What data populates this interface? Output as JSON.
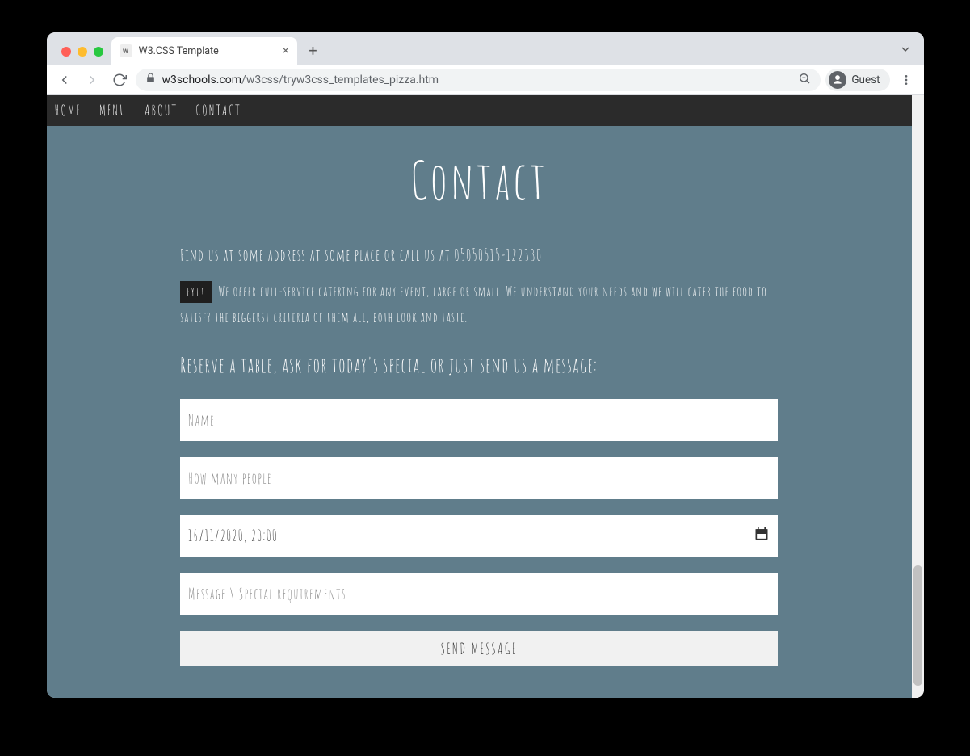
{
  "browser": {
    "tab_title": "W3.CSS Template",
    "url_host": "w3schools.com",
    "url_path": "/w3css/tryw3css_templates_pizza.htm",
    "guest_label": "Guest"
  },
  "nav": {
    "items": [
      "HOME",
      "MENU",
      "ABOUT",
      "CONTACT"
    ]
  },
  "contact": {
    "heading": "Contact",
    "lead": "Find us at some address at some place or call us at 05050515-122330",
    "fyi_tag": "FYI!",
    "fyi_text": "We offer full-service catering for any event, large or small. We understand your needs and we will cater the food to satisfy the biggerst criteria of them all, both look and taste.",
    "reserve": "Reserve a table, ask for today's special or just send us a message:",
    "form": {
      "name_placeholder": "Name",
      "people_placeholder": "How many people",
      "date_value": "16/11/2020, 20:00",
      "message_placeholder": "Message \\ Special requirements",
      "send_label": "SEND MESSAGE"
    }
  }
}
